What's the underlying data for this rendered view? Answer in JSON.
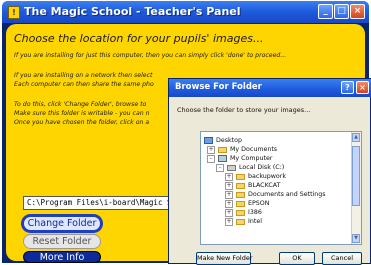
{
  "main_window": {
    "title": "The Magic School - Teacher's Panel",
    "title_icon_glyph": "!",
    "controls": {
      "minimize": "_",
      "maximize": "□",
      "close": "×"
    }
  },
  "panel": {
    "heading": "Choose the location for your pupils' images...",
    "lines": [
      "If you are installing for just this computer, then you can simply click 'done' to proceed...",
      "If you are installing on a network then select",
      "Each computer can then share the same pho",
      "To do this, click 'Change Folder', browse to",
      "Make sure this folder is writable - you can n",
      "Once you have chosen the folder, click on a"
    ],
    "path_value": "C:\\Program Files\\i-board\\Magic School",
    "buttons": {
      "change_folder": "Change Folder",
      "reset_folder": "Reset Folder",
      "more_info": "More Info"
    }
  },
  "dialog": {
    "title": "Browse For Folder",
    "help_glyph": "?",
    "close_glyph": "×",
    "prompt": "Choose the folder to store your images...",
    "tree": [
      {
        "label": "Desktop",
        "icon": "desktop-icon",
        "expander": ""
      },
      {
        "label": "My Documents",
        "icon": "folder-icon",
        "expander": "+"
      },
      {
        "label": "My Computer",
        "icon": "computer-icon",
        "expander": "-"
      },
      {
        "label": "Local Disk (C:)",
        "icon": "disk-icon",
        "expander": "-"
      },
      {
        "label": "backupwork",
        "icon": "folder-icon",
        "expander": "+"
      },
      {
        "label": "BLACKCAT",
        "icon": "folder-icon",
        "expander": "+"
      },
      {
        "label": "Documents and Settings",
        "icon": "folder-icon",
        "expander": "+"
      },
      {
        "label": "EPSON",
        "icon": "folder-icon",
        "expander": "+"
      },
      {
        "label": "I386",
        "icon": "folder-icon",
        "expander": "+"
      },
      {
        "label": "Intel",
        "icon": "folder-icon",
        "expander": "+"
      }
    ],
    "scroll_up_glyph": "▲",
    "scroll_down_glyph": "▼",
    "buttons": {
      "make_new_folder": "Make New Folder",
      "ok": "OK",
      "cancel": "Cancel"
    }
  },
  "colors": {
    "panel_background": "#ffd500",
    "titlebar_blue": "#1d5adb",
    "button_navy": "#0c2a9a"
  }
}
